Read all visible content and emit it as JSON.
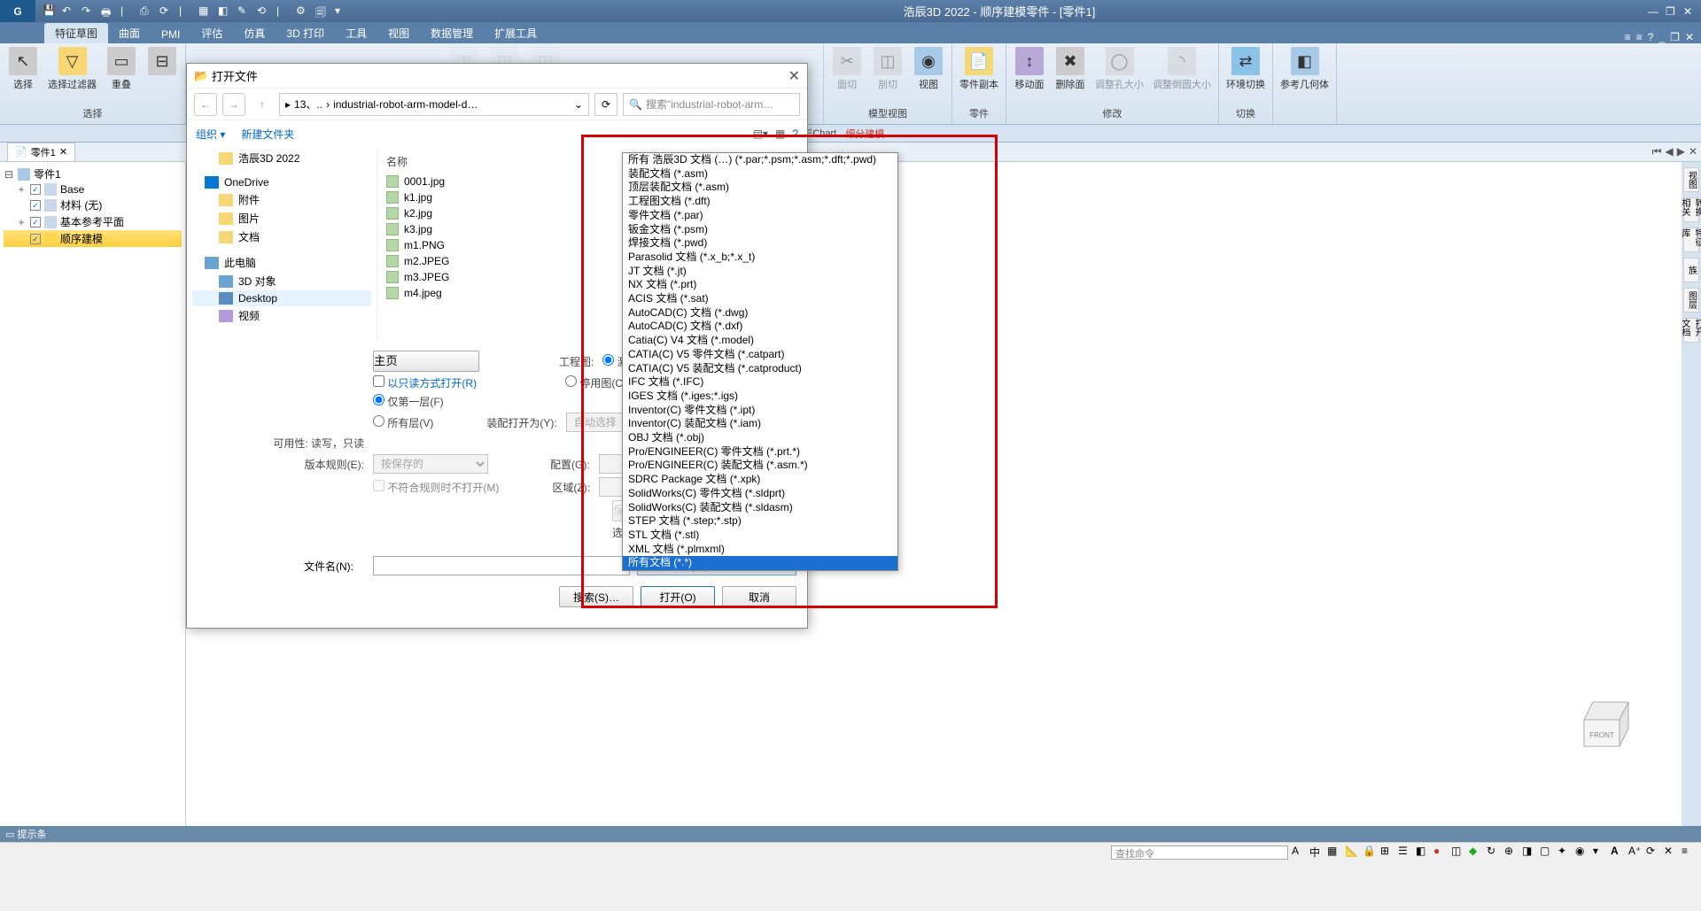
{
  "title": "浩辰3D 2022 - 顺序建模零件 - [零件1]",
  "logo": "G",
  "tabs": [
    "特征草图",
    "曲面",
    "PMI",
    "评估",
    "仿真",
    "3D 打印",
    "工具",
    "视图",
    "数据管理",
    "扩展工具"
  ],
  "active_tab": 0,
  "ribbon": {
    "group1": {
      "btns": [
        "选择",
        "选择过滤器",
        "重叠"
      ],
      "label": "选择"
    },
    "group2": {
      "label": "模型视图",
      "btns": [
        "...",
        "...",
        "面切",
        "剖切",
        "视图"
      ]
    },
    "group3": {
      "label": "零件",
      "btns": [
        "零件副本"
      ]
    },
    "group4": {
      "label": "修改",
      "btns": [
        "移动面",
        "删除面",
        "调整孔大小",
        "调整倒圆大小"
      ]
    },
    "group5": {
      "label": "切换",
      "btns": [
        "环境切换"
      ]
    },
    "group6": {
      "btns": [
        "参考几何体"
      ]
    }
  },
  "subtool": [
    "EChart",
    "细分建模"
  ],
  "doc_tab": {
    "name": "零件1"
  },
  "tree": {
    "root": "零件1",
    "items": [
      {
        "exp": "+",
        "chk": true,
        "name": "Base"
      },
      {
        "exp": "",
        "chk": true,
        "name": "材料 (无)"
      },
      {
        "exp": "+",
        "chk": true,
        "name": "基本参考平面"
      },
      {
        "exp": "",
        "chk": true,
        "name": "顺序建模",
        "sel": true
      }
    ]
  },
  "rpanel": [
    "视图",
    "转换相关",
    "特征库",
    "族",
    "图层",
    "打开文档"
  ],
  "status": "提示条",
  "cmd_placeholder": "查找命令",
  "viewcube": "FRONT",
  "dialog": {
    "title": "打开文件",
    "crumb": [
      "«",
      "13、..",
      "industrial-robot-arm-model-d…"
    ],
    "search_ph": "搜索\"industrial-robot-arm…",
    "organize": "组织",
    "new_folder": "新建文件夹",
    "side": [
      {
        "name": "浩辰3D 2022",
        "ico": "i-folder",
        "indent": 1
      },
      {
        "name": "OneDrive",
        "ico": "i-one",
        "indent": 0,
        "gap": true
      },
      {
        "name": "附件",
        "ico": "i-folder",
        "indent": 1
      },
      {
        "name": "图片",
        "ico": "i-folder",
        "indent": 1
      },
      {
        "name": "文档",
        "ico": "i-folder",
        "indent": 1
      },
      {
        "name": "此电脑",
        "ico": "i-pc",
        "indent": 0,
        "gap": true
      },
      {
        "name": "3D 对象",
        "ico": "i-pc",
        "indent": 1
      },
      {
        "name": "Desktop",
        "ico": "i-desk",
        "indent": 1,
        "sel": true
      },
      {
        "name": "视频",
        "ico": "i-vid",
        "indent": 1
      }
    ],
    "hdr_name": "名称",
    "files": [
      "0001.jpg",
      "k1.jpg",
      "k2.jpg",
      "k3.jpg",
      "m1.PNG",
      "m2.JPEG",
      "m3.JPEG",
      "m4.jpeg"
    ],
    "main_btn": "主页",
    "readonly": "以只读方式打开(R)",
    "only_layer": "仅第一层(F)",
    "all_layer": "所有层(V)",
    "avail_lbl": "可用性: 读写，只读",
    "ver_lbl": "版本规则(E):",
    "ver_val": "按保存的",
    "no_rule": "不符合规则时不打开(M)",
    "eng_lbl": "工程图:",
    "activate": "激活图(A)",
    "deactivate": "停用图(C)",
    "asm_lbl": "装配打开为(Y):",
    "asm_val": "自动选择",
    "cfg_lbl": "配置(G):",
    "zone_lbl": "区域(Z):",
    "save": "保存",
    "select": "选",
    "filename_lbl": "文件名(N):",
    "filetype_sel": "所有文档 (*.*)",
    "search_btn": "搜索(S)…",
    "open_btn": "打开(O)",
    "cancel_btn": "取消"
  },
  "file_types": [
    "所有 浩辰3D 文档 (…) (*.par;*.psm;*.asm;*.dft;*.pwd)",
    "装配文档 (*.asm)",
    "顶层装配文档 (*.asm)",
    "工程图文档 (*.dft)",
    "零件文档 (*.par)",
    "钣金文档 (*.psm)",
    "焊接文档 (*.pwd)",
    "Parasolid 文档 (*.x_b;*.x_t)",
    "JT 文档 (*.jt)",
    "NX 文档 (*.prt)",
    "ACIS 文档 (*.sat)",
    "AutoCAD(C) 文档 (*.dwg)",
    "AutoCAD(C) 文档 (*.dxf)",
    "Catia(C) V4 文档 (*.model)",
    "CATIA(C) V5 零件文档 (*.catpart)",
    "CATIA(C) V5 装配文档 (*.catproduct)",
    "IFC 文档 (*.IFC)",
    "IGES 文档 (*.iges;*.igs)",
    "Inventor(C) 零件文档 (*.ipt)",
    "Inventor(C) 装配文档 (*.iam)",
    "OBJ 文档 (*.obj)",
    "Pro/ENGINEER(C) 零件文档 (*.prt.*)",
    "Pro/ENGINEER(C) 装配文档 (*.asm.*)",
    "SDRC Package 文档 (*.xpk)",
    "SolidWorks(C) 零件文档 (*.sldprt)",
    "SolidWorks(C) 装配文档 (*.sldasm)",
    "STEP 文档 (*.step;*.stp)",
    "STL 文档 (*.stl)",
    "XML 文档 (*.plmxml)",
    "所有文档 (*.*)"
  ],
  "file_type_selected": 29
}
